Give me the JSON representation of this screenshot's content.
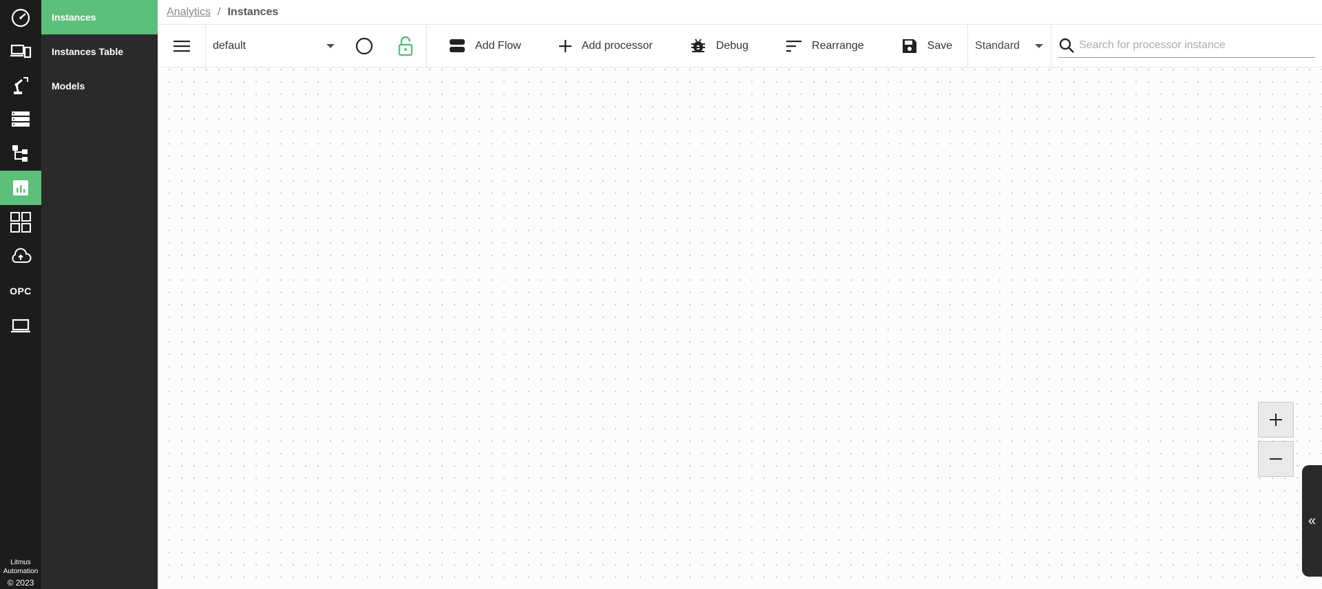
{
  "rail": {
    "items": [
      {
        "name": "dashboard-icon"
      },
      {
        "name": "devices-icon"
      },
      {
        "name": "robot-arm-icon"
      },
      {
        "name": "database-icon"
      },
      {
        "name": "flows-icon"
      },
      {
        "name": "analytics-icon",
        "active": true
      },
      {
        "name": "apps-grid-icon"
      },
      {
        "name": "cloud-upload-icon"
      },
      {
        "name": "opc-label",
        "label": "OPC"
      },
      {
        "name": "laptop-icon"
      }
    ],
    "footer": {
      "brand_line1": "Litmus",
      "brand_line2": "Automation",
      "copyright": "© 2023"
    }
  },
  "subnav": {
    "items": [
      {
        "label": "Instances",
        "active": true
      },
      {
        "label": "Instances Table"
      },
      {
        "label": "Models"
      }
    ]
  },
  "breadcrumb": {
    "parent": "Analytics",
    "separator": "/",
    "current": "Instances"
  },
  "toolbar": {
    "flow_select": "default",
    "add_flow": "Add Flow",
    "add_processor": "Add processor",
    "debug": "Debug",
    "rearrange": "Rearrange",
    "save": "Save",
    "mode": "Standard",
    "search_placeholder": "Search for processor instance"
  },
  "zoom": {
    "in": "+",
    "out": "−"
  },
  "panel_toggle": "«",
  "colors": {
    "accent": "#5cbf7a",
    "rail_bg": "#1c1c1c",
    "subnav_bg": "#2a2a2a"
  }
}
